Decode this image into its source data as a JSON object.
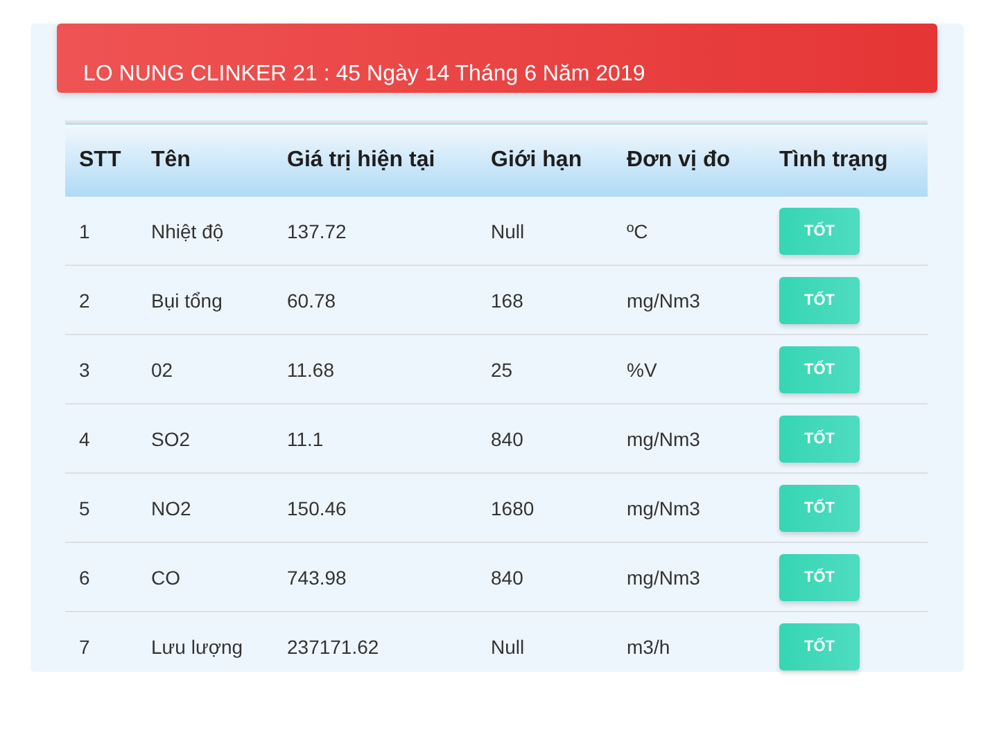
{
  "header": {
    "title": "LO NUNG CLINKER 21 : 45 Ngày 14 Tháng 6 Năm 2019"
  },
  "table": {
    "columns": [
      "STT",
      "Tên",
      "Giá trị hiện tại",
      "Giới hạn",
      "Đơn vị đo",
      "Tình trạng"
    ],
    "rows": [
      {
        "cells": [
          "1",
          "Nhiệt độ",
          "137.72",
          "Null",
          "ºC"
        ],
        "status": "TỐT"
      },
      {
        "cells": [
          "2",
          "Bụi tổng",
          "60.78",
          "168",
          "mg/Nm3"
        ],
        "status": "TỐT"
      },
      {
        "cells": [
          "3",
          "02",
          "11.68",
          "25",
          "%V"
        ],
        "status": "TỐT"
      },
      {
        "cells": [
          "4",
          "SO2",
          "11.1",
          "840",
          "mg/Nm3"
        ],
        "status": "TỐT"
      },
      {
        "cells": [
          "5",
          "NO2",
          "150.46",
          "1680",
          "mg/Nm3"
        ],
        "status": "TỐT"
      },
      {
        "cells": [
          "6",
          "CO",
          "743.98",
          "840",
          "mg/Nm3"
        ],
        "status": "TỐT"
      },
      {
        "cells": [
          "7",
          "Lưu lượng",
          "237171.62",
          "Null",
          "m3/h"
        ],
        "status": "TỐT"
      }
    ]
  }
}
